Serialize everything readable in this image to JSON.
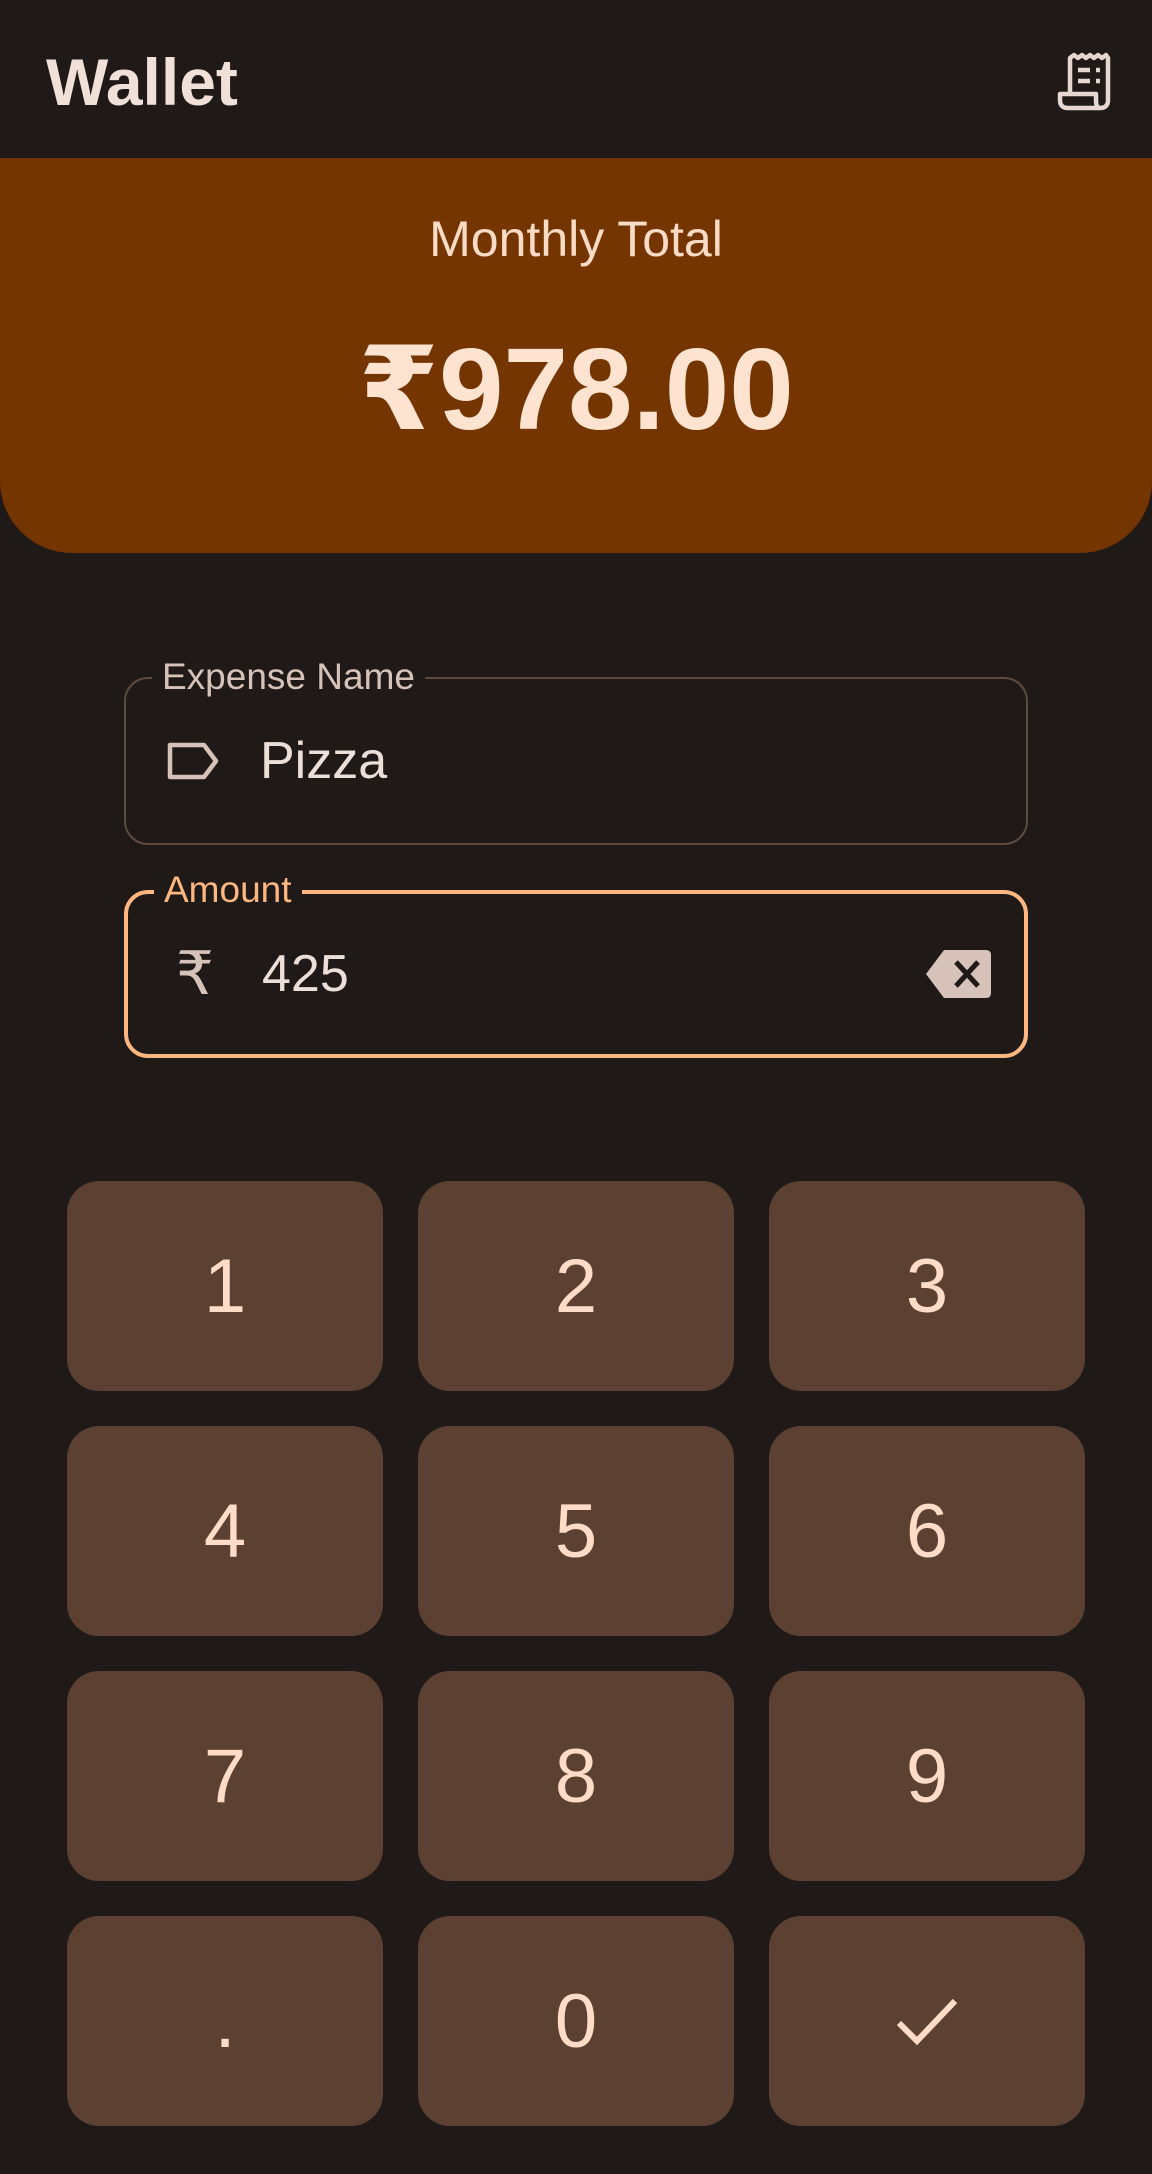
{
  "header": {
    "title": "Wallet",
    "receipt_icon": "receipt-long-icon"
  },
  "summary": {
    "label": "Monthly Total",
    "value": "₹978.00"
  },
  "expense_name": {
    "label": "Expense Name",
    "value": "Pizza",
    "icon": "label-tag-icon"
  },
  "amount": {
    "label": "Amount",
    "value": "425",
    "currency_symbol": "₹",
    "clear_icon": "backspace-icon"
  },
  "keypad": {
    "keys": [
      "1",
      "2",
      "3",
      "4",
      "5",
      "6",
      "7",
      "8",
      "9",
      ".",
      "0"
    ],
    "confirm_icon": "check-icon"
  },
  "colors": {
    "background": "#1f1a17",
    "summary_card": "#743500",
    "accent": "#ffb781",
    "key_background": "#5c4031",
    "key_text": "#ffdcc8"
  }
}
